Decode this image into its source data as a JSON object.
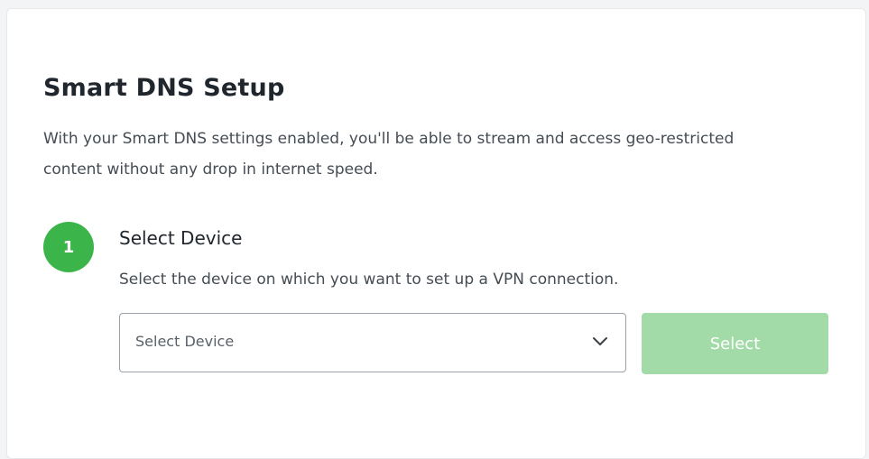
{
  "setup": {
    "title": "Smart DNS Setup",
    "intro": "With your Smart DNS settings enabled, you'll be able to stream and access geo-restricted content without any drop in internet speed."
  },
  "step": {
    "number": "1",
    "title": "Select Device",
    "description": "Select the device on which you want to set up a VPN connection.",
    "dropdown": {
      "placeholder": "Select Device",
      "icon": "chevron-down-icon"
    },
    "button": {
      "label": "Select",
      "state": "disabled"
    }
  },
  "colors": {
    "accent": "#3bb54a",
    "button_disabled": "#a3dba8",
    "title_text": "#20262d",
    "body_text": "#454c54"
  }
}
